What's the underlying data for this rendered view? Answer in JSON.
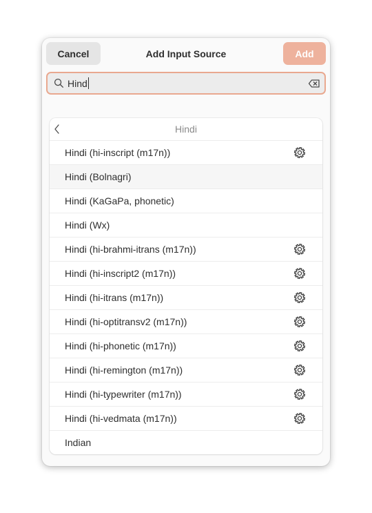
{
  "dialog": {
    "title": "Add Input Source",
    "cancel_label": "Cancel",
    "add_label": "Add",
    "accent_color": "#e95420"
  },
  "search": {
    "value": "Hind"
  },
  "list": {
    "header": "Hindi",
    "items": [
      {
        "label": "Hindi (hi-inscript (m17n))",
        "has_settings": true
      },
      {
        "label": "Hindi (Bolnagri)",
        "has_settings": false,
        "highlighted": true
      },
      {
        "label": "Hindi (KaGaPa, phonetic)",
        "has_settings": false
      },
      {
        "label": "Hindi (Wx)",
        "has_settings": false
      },
      {
        "label": "Hindi (hi-brahmi-itrans (m17n))",
        "has_settings": true
      },
      {
        "label": "Hindi (hi-inscript2 (m17n))",
        "has_settings": true
      },
      {
        "label": "Hindi (hi-itrans (m17n))",
        "has_settings": true
      },
      {
        "label": "Hindi (hi-optitransv2 (m17n))",
        "has_settings": true
      },
      {
        "label": "Hindi (hi-phonetic (m17n))",
        "has_settings": true
      },
      {
        "label": "Hindi (hi-remington (m17n))",
        "has_settings": true
      },
      {
        "label": "Hindi (hi-typewriter (m17n))",
        "has_settings": true
      },
      {
        "label": "Hindi (hi-vedmata (m17n))",
        "has_settings": true
      },
      {
        "label": "Indian",
        "has_settings": false
      }
    ]
  }
}
